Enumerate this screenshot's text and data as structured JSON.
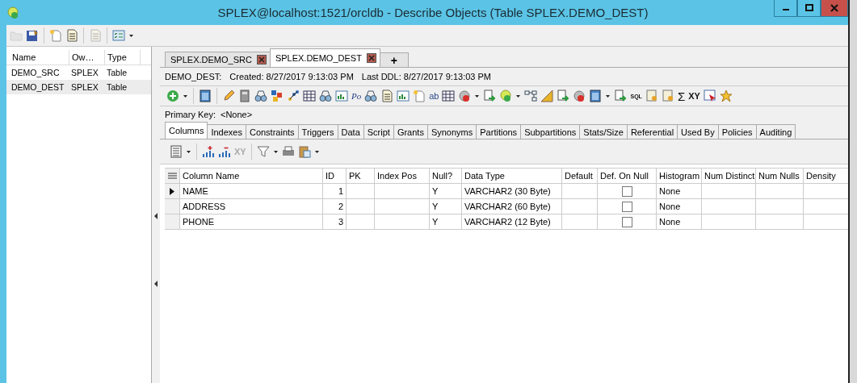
{
  "window": {
    "title": "SPLEX@localhost:1521/orcldb - Describe Objects (Table SPLEX.DEMO_DEST)"
  },
  "object_list": {
    "columns": [
      "Name",
      "Ow…",
      "Type"
    ],
    "rows": [
      {
        "cells": [
          "DEMO_SRC",
          "SPLEX",
          "Table"
        ],
        "selected": false
      },
      {
        "cells": [
          "DEMO_DEST",
          "SPLEX",
          "Table"
        ],
        "selected": true
      }
    ]
  },
  "doc_tabs": [
    {
      "label": "SPLEX.DEMO_SRC",
      "selected": false
    },
    {
      "label": "SPLEX.DEMO_DEST",
      "selected": true
    }
  ],
  "new_tab_label": "+",
  "info": {
    "object": "DEMO_DEST:",
    "created": "Created: 8/27/2017 9:13:03 PM",
    "last_ddl": "Last DDL: 8/27/2017 9:13:03 PM"
  },
  "object_toolbar": {
    "glyphs": [
      "Po",
      "ab",
      "SQL",
      "Σ",
      "XY"
    ]
  },
  "primary_key": {
    "label": "Primary Key:",
    "value": "<None>"
  },
  "detail_tabs": [
    {
      "label": "Columns",
      "selected": true
    },
    {
      "label": "Indexes",
      "selected": false
    },
    {
      "label": "Constraints",
      "selected": false
    },
    {
      "label": "Triggers",
      "selected": false
    },
    {
      "label": "Data",
      "selected": false
    },
    {
      "label": "Script",
      "selected": false
    },
    {
      "label": "Grants",
      "selected": false
    },
    {
      "label": "Synonyms",
      "selected": false
    },
    {
      "label": "Partitions",
      "selected": false
    },
    {
      "label": "Subpartitions",
      "selected": false
    },
    {
      "label": "Stats/Size",
      "selected": false
    },
    {
      "label": "Referential",
      "selected": false
    },
    {
      "label": "Used By",
      "selected": false
    },
    {
      "label": "Policies",
      "selected": false
    },
    {
      "label": "Auditing",
      "selected": false
    }
  ],
  "grid_toolbar": {
    "glyph": "XY"
  },
  "grid": {
    "columns": [
      "Column Name",
      "ID",
      "PK",
      "Index Pos",
      "Null?",
      "Data Type",
      "Default",
      "Def. On Null",
      "Histogram",
      "Num Distinct",
      "Num Nulls",
      "Density"
    ],
    "rows": [
      {
        "name": "NAME",
        "id": "1",
        "nullable": "Y",
        "data_type": "VARCHAR2 (30 Byte)",
        "def_on_null": false,
        "histogram": "None",
        "current": true
      },
      {
        "name": "ADDRESS",
        "id": "2",
        "nullable": "Y",
        "data_type": "VARCHAR2 (60 Byte)",
        "def_on_null": false,
        "histogram": "None",
        "current": false
      },
      {
        "name": "PHONE",
        "id": "3",
        "nullable": "Y",
        "data_type": "VARCHAR2 (12 Byte)",
        "def_on_null": false,
        "histogram": "None",
        "current": false
      }
    ]
  }
}
